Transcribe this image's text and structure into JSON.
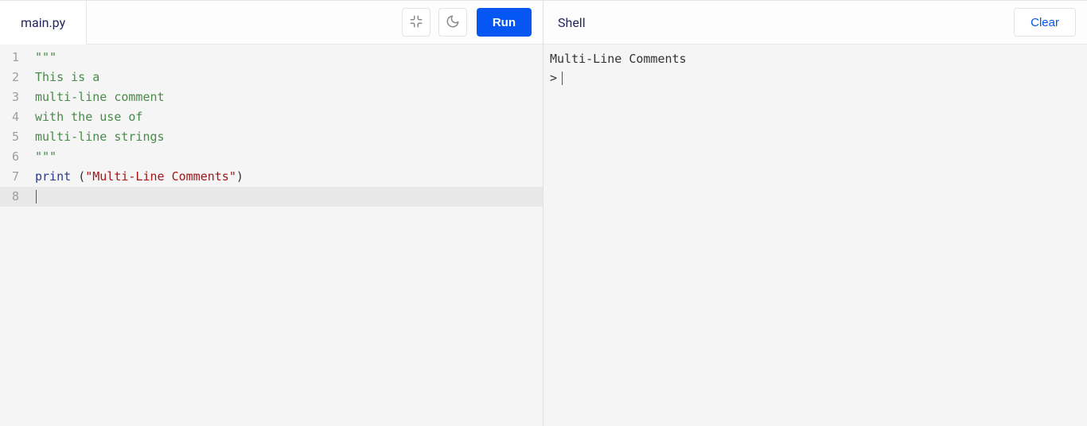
{
  "editor": {
    "tab_label": "main.py",
    "run_label": "Run",
    "icons": {
      "collapse": "collapse-icon",
      "theme": "moon-icon"
    },
    "lines": [
      {
        "n": "1",
        "tokens": [
          {
            "t": "\"\"\"",
            "c": "tok-comment"
          }
        ]
      },
      {
        "n": "2",
        "tokens": [
          {
            "t": "This is a",
            "c": "tok-comment"
          }
        ]
      },
      {
        "n": "3",
        "tokens": [
          {
            "t": "multi-line comment",
            "c": "tok-comment"
          }
        ]
      },
      {
        "n": "4",
        "tokens": [
          {
            "t": "with the use of",
            "c": "tok-comment"
          }
        ]
      },
      {
        "n": "5",
        "tokens": [
          {
            "t": "multi-line strings",
            "c": "tok-comment"
          }
        ]
      },
      {
        "n": "6",
        "tokens": [
          {
            "t": "\"\"\"",
            "c": "tok-comment"
          }
        ]
      },
      {
        "n": "7",
        "tokens": [
          {
            "t": "print",
            "c": "tok-keyword"
          },
          {
            "t": " ",
            "c": ""
          },
          {
            "t": "(",
            "c": "tok-paren"
          },
          {
            "t": "\"Multi-Line Comments\"",
            "c": "tok-string"
          },
          {
            "t": ")",
            "c": "tok-paren"
          }
        ]
      },
      {
        "n": "8",
        "tokens": [],
        "current": true,
        "cursor": true
      }
    ]
  },
  "shell": {
    "label": "Shell",
    "clear_label": "Clear",
    "output": [
      "Multi-Line Comments"
    ],
    "prompt": ">"
  }
}
